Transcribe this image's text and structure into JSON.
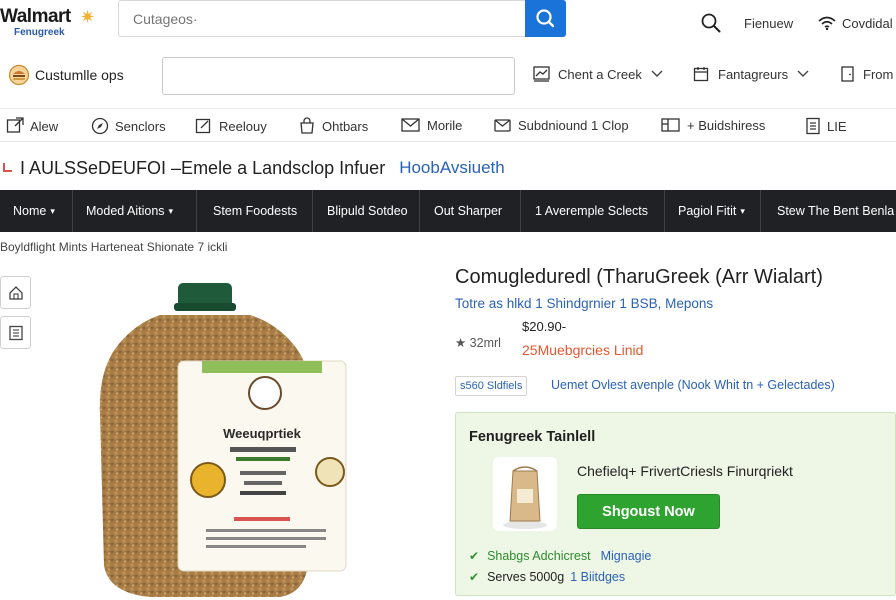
{
  "brand": {
    "name": "Walmart",
    "sub": "Fenugreek"
  },
  "search": {
    "placeholder": "Cutageos·"
  },
  "top_right": {
    "item1": "Fienuew",
    "item2": "Covdidal"
  },
  "row2": {
    "customer": "Custumlle ops",
    "item1": "Chent a Creek",
    "item2": "Fantagreurs",
    "item3": "From"
  },
  "row3": {
    "items": [
      "Alew",
      "Senclors",
      "Reelouy",
      "Ohtbars",
      "Morile",
      "Subdniound 1 Clop",
      "+ Buidshiress",
      "LIE"
    ]
  },
  "headline": {
    "main": "I AULSSeDEUFOI –Emele a Landsclop Infuer",
    "link": "HoobAvsiueth"
  },
  "nav": {
    "items": [
      "Nome",
      "Moded Aitions",
      "Stem Foodests",
      "Blipuld Sotdeo",
      "Out Sharper",
      "1 Averemple Sclects",
      "Pagiol Fitit",
      "Stew The Bent Benla"
    ]
  },
  "breadcrumb": "Boyldflight Mints  Harteneat Shionate 7 ickli",
  "product": {
    "label_title": "Weeuqprtiek",
    "title": "Comugleduredl (TharuGreek (Arr Wialart)",
    "sub": "Totre as hlkd 1 Shindgrnier 1 BSB, Mepons",
    "price": "$20.90-",
    "rating": "★ 32mrl",
    "deal": "25Muebgrcies Linid",
    "chip": "s560 Sldfiels",
    "chip_note": "Uemet Ovlest avenple (Nook Whit tn + Gelectades)"
  },
  "card": {
    "title": "Fenugreek Tainlell",
    "product": "Chefielq+ FrivertCriesls Finurqriekt",
    "button": "Shgoust Now",
    "feature1": {
      "label": "Shabgs Adchicrest",
      "link": "Mignagie"
    },
    "feature2": {
      "label": "Serves 5000g",
      "link": "1 Biitdges"
    }
  },
  "colors": {
    "search_button": "#1a73d9",
    "nav_bg": "#1f2124",
    "link": "#2a62b5",
    "deal": "#e4572e",
    "card_bg": "#eef7e6",
    "button": "#2fa32f"
  }
}
